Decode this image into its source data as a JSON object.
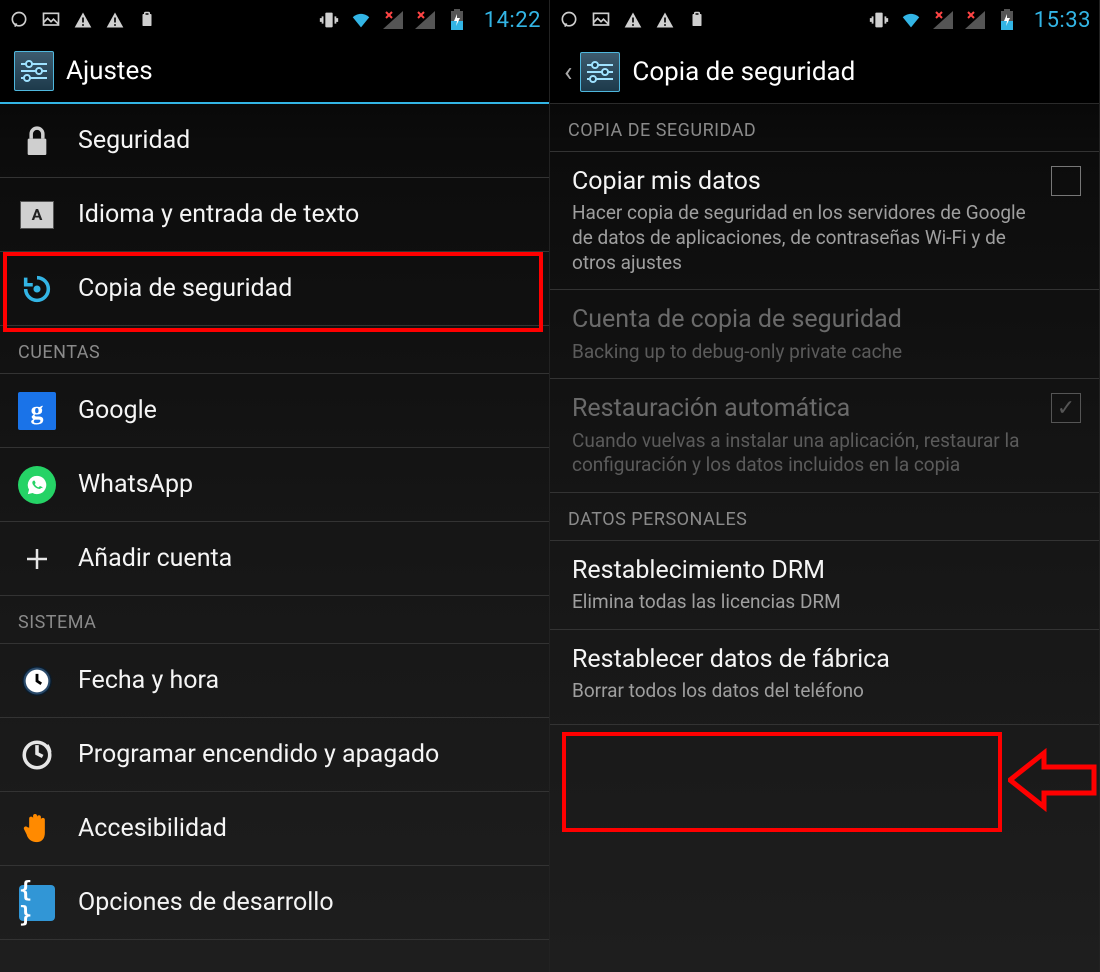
{
  "left": {
    "status": {
      "time": "14:22"
    },
    "title": "Ajustes",
    "rows": {
      "security": "Seguridad",
      "language": "Idioma y entrada de texto",
      "backup": "Copia de seguridad"
    },
    "section_accounts": "CUENTAS",
    "account_google": "Google",
    "account_whatsapp": "WhatsApp",
    "add_account": "Añadir cuenta",
    "section_system": "SISTEMA",
    "datetime": "Fecha y hora",
    "schedule_power": "Programar encendido y apagado",
    "accessibility": "Accesibilidad",
    "dev_options": "Opciones de desarrollo"
  },
  "right": {
    "status": {
      "time": "15:33"
    },
    "title": "Copia de seguridad",
    "section_backup": "COPIA DE SEGURIDAD",
    "copy_data": {
      "label": "Copiar mis datos",
      "sub": "Hacer copia de seguridad en los servidores de Google de datos de aplicaciones, de contraseñas Wi-Fi y de otros ajustes"
    },
    "backup_account": {
      "label": "Cuenta de copia de seguridad",
      "sub": "Backing up to debug-only private cache"
    },
    "auto_restore": {
      "label": "Restauración automática",
      "sub": "Cuando vuelvas a instalar una aplicación, restaurar la configuración y los datos incluidos en la copia"
    },
    "section_personal": "DATOS PERSONALES",
    "drm": {
      "label": "Restablecimiento DRM",
      "sub": "Elimina todas las licencias DRM"
    },
    "factory": {
      "label": "Restablecer datos de fábrica",
      "sub": "Borrar todos los datos del teléfono"
    }
  }
}
